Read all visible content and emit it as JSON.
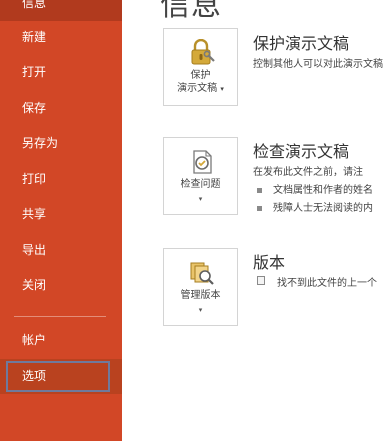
{
  "sidebar": {
    "items": [
      {
        "label": "信息"
      },
      {
        "label": "新建"
      },
      {
        "label": "打开"
      },
      {
        "label": "保存"
      },
      {
        "label": "另存为"
      },
      {
        "label": "打印"
      },
      {
        "label": "共享"
      },
      {
        "label": "导出"
      },
      {
        "label": "关闭"
      }
    ],
    "bottom_items": [
      {
        "label": "帐户"
      },
      {
        "label": "选项"
      }
    ]
  },
  "main": {
    "title": "信息",
    "sections": [
      {
        "tile_line1": "保护",
        "tile_line2": "演示文稿",
        "tile_line2_caret": "▾",
        "heading": "保护演示文稿",
        "description": "控制其他人可以对此演示文稿"
      },
      {
        "tile_line1": "检查问题",
        "tile_caret": "▾",
        "heading": "检查演示文稿",
        "description": "在发布此文件之前，请注",
        "bullets": [
          "文档属性和作者的姓名",
          "残障人士无法阅读的内"
        ]
      },
      {
        "tile_line1": "管理版本",
        "tile_caret": "▾",
        "heading": "版本",
        "description": "找不到此文件的上一个"
      }
    ]
  },
  "colors": {
    "sidebar": "#d24726",
    "sidebar_active": "#b13a1e",
    "focus_ring": "#6f7a9c",
    "icon_gold": "#d4a93a"
  }
}
